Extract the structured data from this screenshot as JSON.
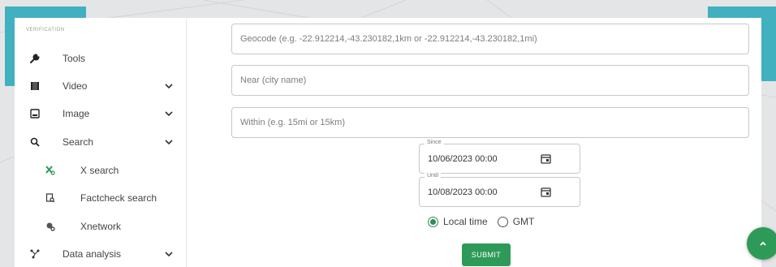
{
  "sidebar": {
    "section_label": "VERIFICATION",
    "items": [
      {
        "label": "Tools",
        "icon": "wrench-icon"
      },
      {
        "label": "Video",
        "icon": "film-icon"
      },
      {
        "label": "Image",
        "icon": "image-icon"
      },
      {
        "label": "Search",
        "icon": "search-icon"
      },
      {
        "label": "X search",
        "icon": "x-search-icon"
      },
      {
        "label": "Factcheck search",
        "icon": "factcheck-icon"
      },
      {
        "label": "Xnetwork",
        "icon": "network-icon"
      },
      {
        "label": "Data analysis",
        "icon": "data-analysis-icon"
      }
    ]
  },
  "form": {
    "geocode_placeholder": "Geocode (e.g. -22.912214,-43.230182,1km or -22.912214,-43.230182,1mi)",
    "near_placeholder": "Near (city name)",
    "within_placeholder": "Within (e.g. 15mi or 15km)",
    "since": {
      "label": "Since",
      "value": "10/06/2023 00:00"
    },
    "until": {
      "label": "Until",
      "value": "10/08/2023 00:00"
    },
    "timezone": {
      "selected": "Local time",
      "options": [
        "Local time",
        "GMT"
      ]
    },
    "submit_label": "SUBMIT"
  },
  "colors": {
    "accent": "#2e9a58",
    "teal": "#41b0bf"
  }
}
